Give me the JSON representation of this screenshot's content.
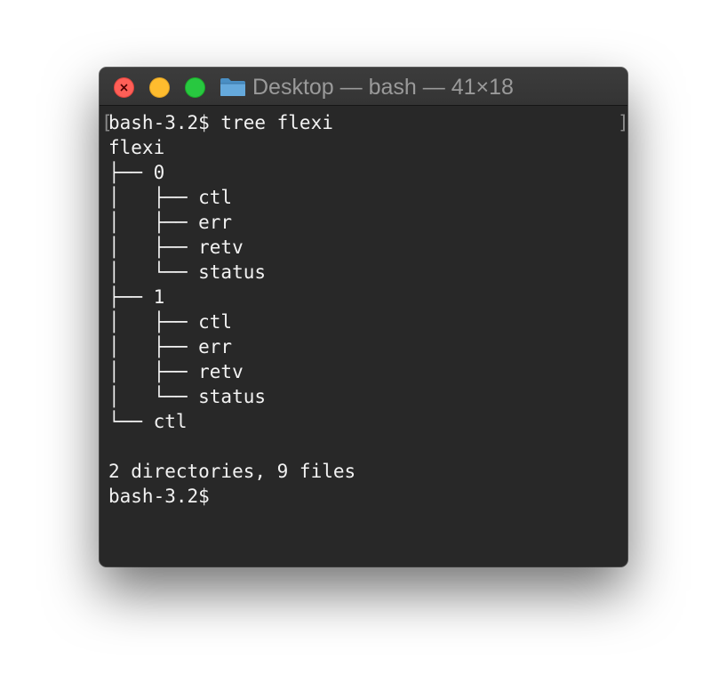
{
  "window": {
    "title": "Desktop — bash — 41×18",
    "folder_icon": "folder-icon",
    "traffic_lights": [
      "close",
      "minimize",
      "zoom"
    ]
  },
  "terminal": {
    "bracket_open": "[",
    "bracket_close": "]",
    "lines": [
      "bash-3.2$ tree flexi",
      "flexi",
      "├── 0",
      "│   ├── ctl",
      "│   ├── err",
      "│   ├── retv",
      "│   └── status",
      "├── 1",
      "│   ├── ctl",
      "│   ├── err",
      "│   ├── retv",
      "│   └── status",
      "└── ctl",
      "",
      "2 directories, 9 files",
      "bash-3.2$"
    ]
  },
  "colors": {
    "background": "#282828",
    "text": "#f2f2f2",
    "title_text": "#9a9a9a",
    "close": "#ff5f57",
    "minimize": "#febc2e",
    "zoom": "#28c840"
  }
}
